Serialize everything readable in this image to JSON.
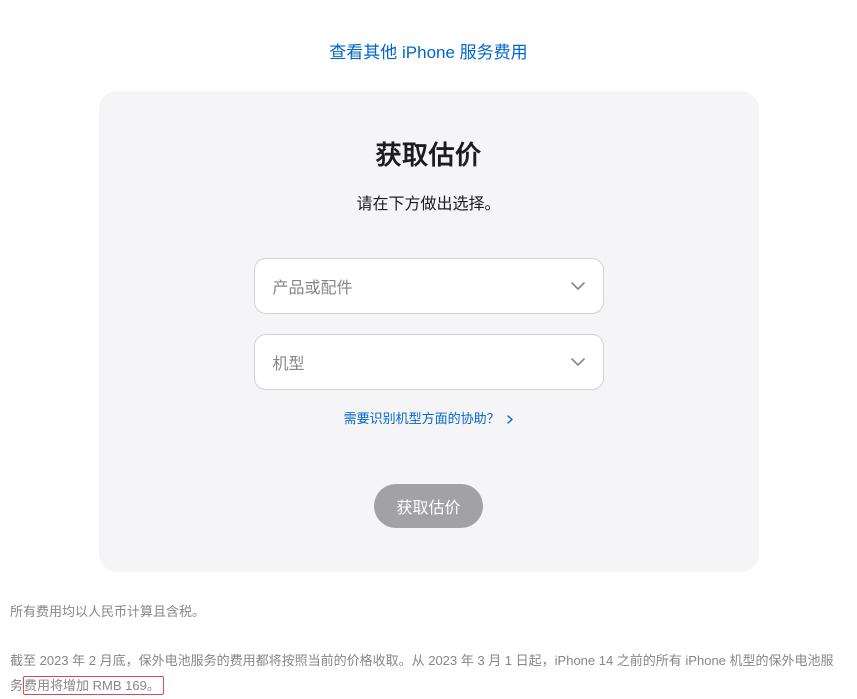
{
  "topLink": {
    "label": "查看其他 iPhone 服务费用"
  },
  "card": {
    "title": "获取估价",
    "subtitle": "请在下方做出选择。",
    "selectProduct": {
      "placeholder": "产品或配件"
    },
    "selectModel": {
      "placeholder": "机型"
    },
    "helpLink": {
      "label": "需要识别机型方面的协助？"
    },
    "submit": {
      "label": "获取估价"
    }
  },
  "footnotes": {
    "line1": "所有费用均以人民币计算且含税。",
    "line2_part1": "截至 2023 年 2 月底，保外电池服务的费用都将按照当前的价格收取。从 2023 年 3 月 1 日起，iPhone 14 之前的所有 iPhone 机型的保外电池服",
    "line2_part2": "务",
    "line2_highlight": "费用将增加 RMB 169。"
  }
}
